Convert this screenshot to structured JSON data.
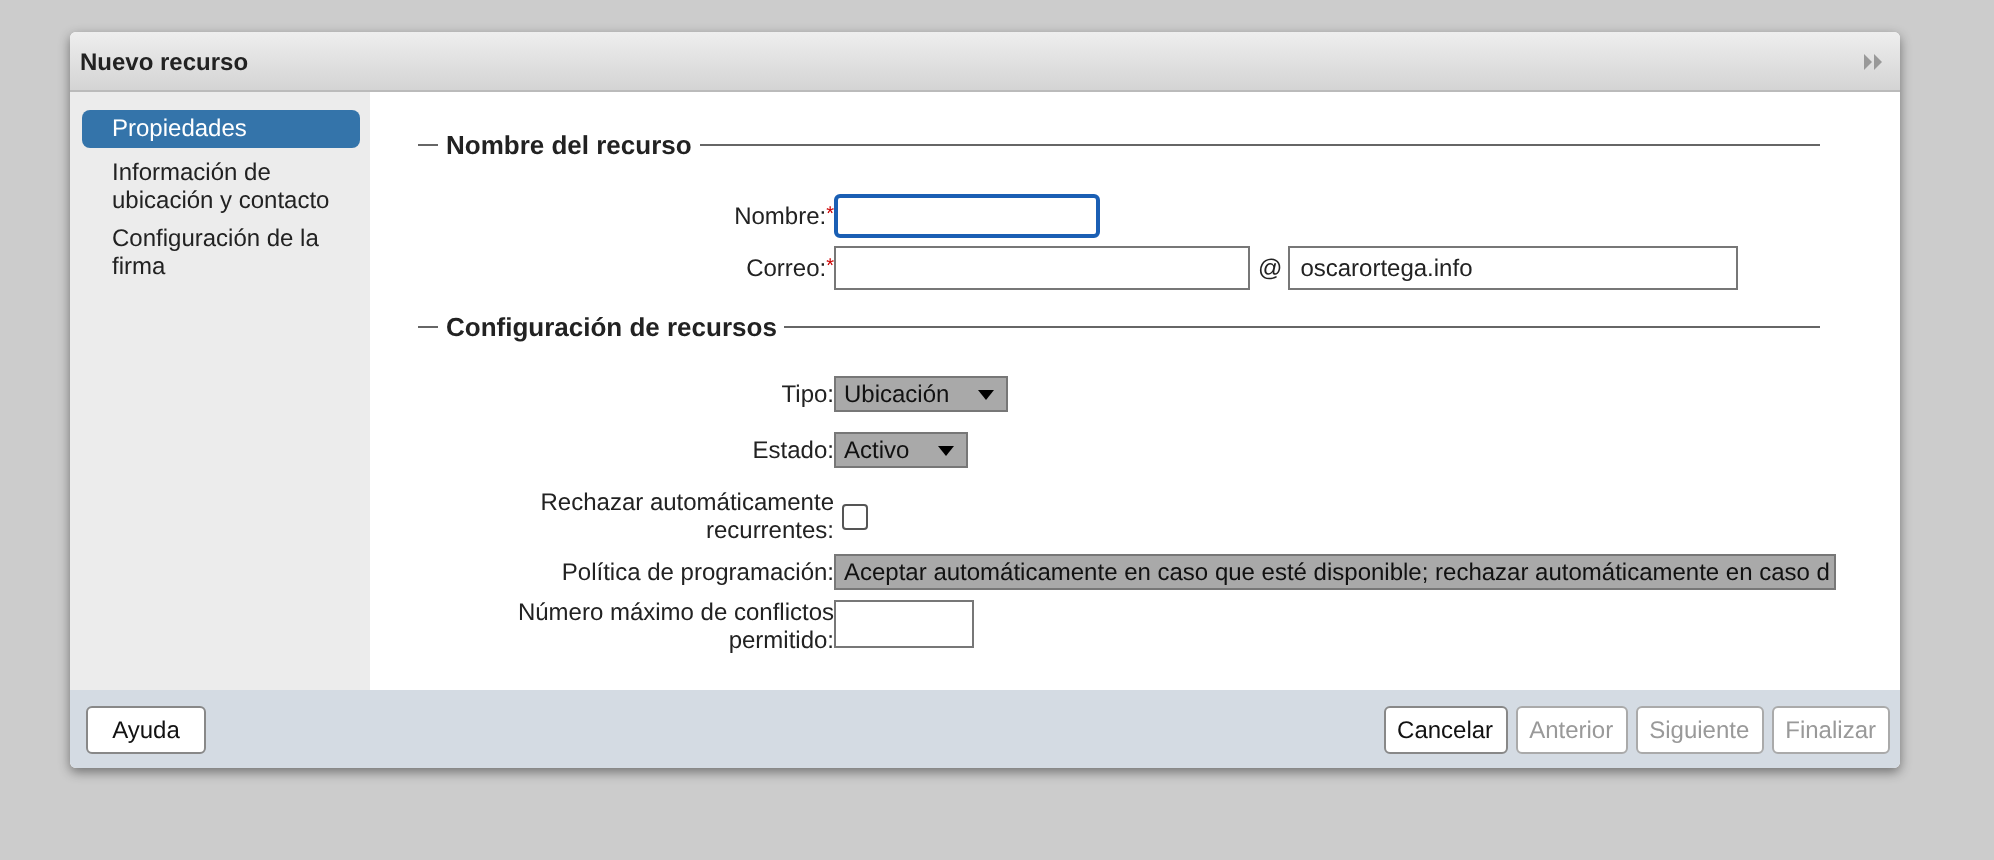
{
  "window": {
    "title": "Nuevo recurso"
  },
  "sidebar": {
    "items": [
      {
        "label": "Propiedades",
        "selected": true
      },
      {
        "label": "Información de ubicación y contacto",
        "selected": false
      },
      {
        "label": "Configuración de la firma",
        "selected": false
      }
    ]
  },
  "sections": [
    {
      "title": "Nombre del recurso",
      "fields": [
        {
          "kind": "text",
          "label": "Nombre:",
          "required": "*",
          "focused": true
        },
        {
          "kind": "email",
          "label": "Correo:",
          "required": "*",
          "at": "@",
          "domain": "oscarortega.info"
        }
      ]
    },
    {
      "title": "Configuración de recursos",
      "fields": [
        {
          "kind": "select",
          "label": "Tipo:",
          "value": "Ubicación"
        },
        {
          "kind": "select",
          "label": "Estado:",
          "value": "Activo"
        },
        {
          "kind": "checkbox",
          "label": "Rechazar automáticamente recurrentes:",
          "checked": false
        },
        {
          "kind": "long-select",
          "label": "Política de programación:",
          "value": "Aceptar automáticamente en caso que esté disponible; rechazar automáticamente en caso d"
        },
        {
          "kind": "number",
          "label": "Número máximo de conflictos permitido:"
        }
      ]
    }
  ],
  "footer": {
    "help": "Ayuda",
    "buttons": [
      {
        "label": "Cancelar",
        "disabled": false
      },
      {
        "label": "Anterior",
        "disabled": true
      },
      {
        "label": "Siguiente",
        "disabled": true
      },
      {
        "label": "Finalizar",
        "disabled": true
      }
    ]
  }
}
